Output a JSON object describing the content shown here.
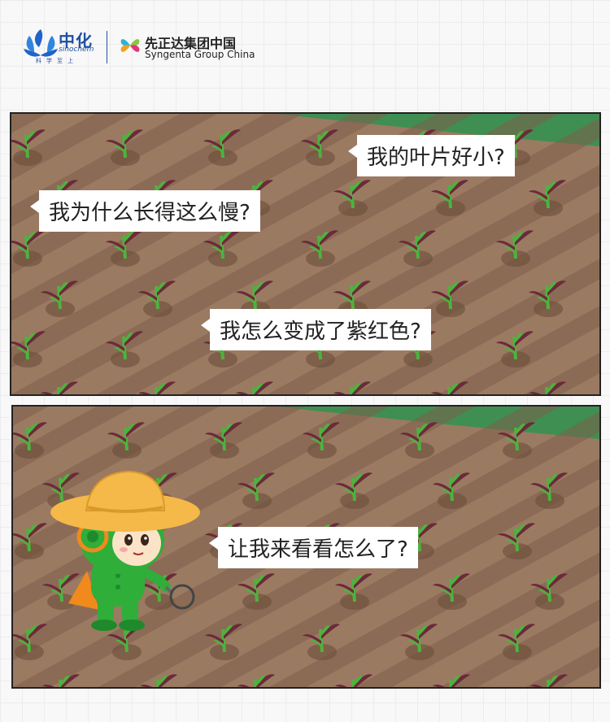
{
  "header": {
    "logo_left": {
      "name_cn": "中化",
      "name_en": "sinochem",
      "tagline": "科学至上"
    },
    "logo_right": {
      "name_cn": "先正达集团中国",
      "name_en": "Syngenta Group China"
    }
  },
  "panel_top": {
    "bubbles": [
      {
        "text": "我的叶片好小?"
      },
      {
        "text": "我为什么长得这么慢?"
      },
      {
        "text": "我怎么变成了紫红色?"
      }
    ]
  },
  "panel_bottom": {
    "bubbles": [
      {
        "text": "让我来看看怎么了?"
      }
    ]
  },
  "colors": {
    "soil": "#9b7a62",
    "furrow": "#7d5e4a",
    "sprout_green": "#4db33d",
    "sprout_purple": "#6b2b3a",
    "grass": "#3f8f52",
    "mascot_green": "#2fae3a",
    "hat": "#f5b94a"
  }
}
